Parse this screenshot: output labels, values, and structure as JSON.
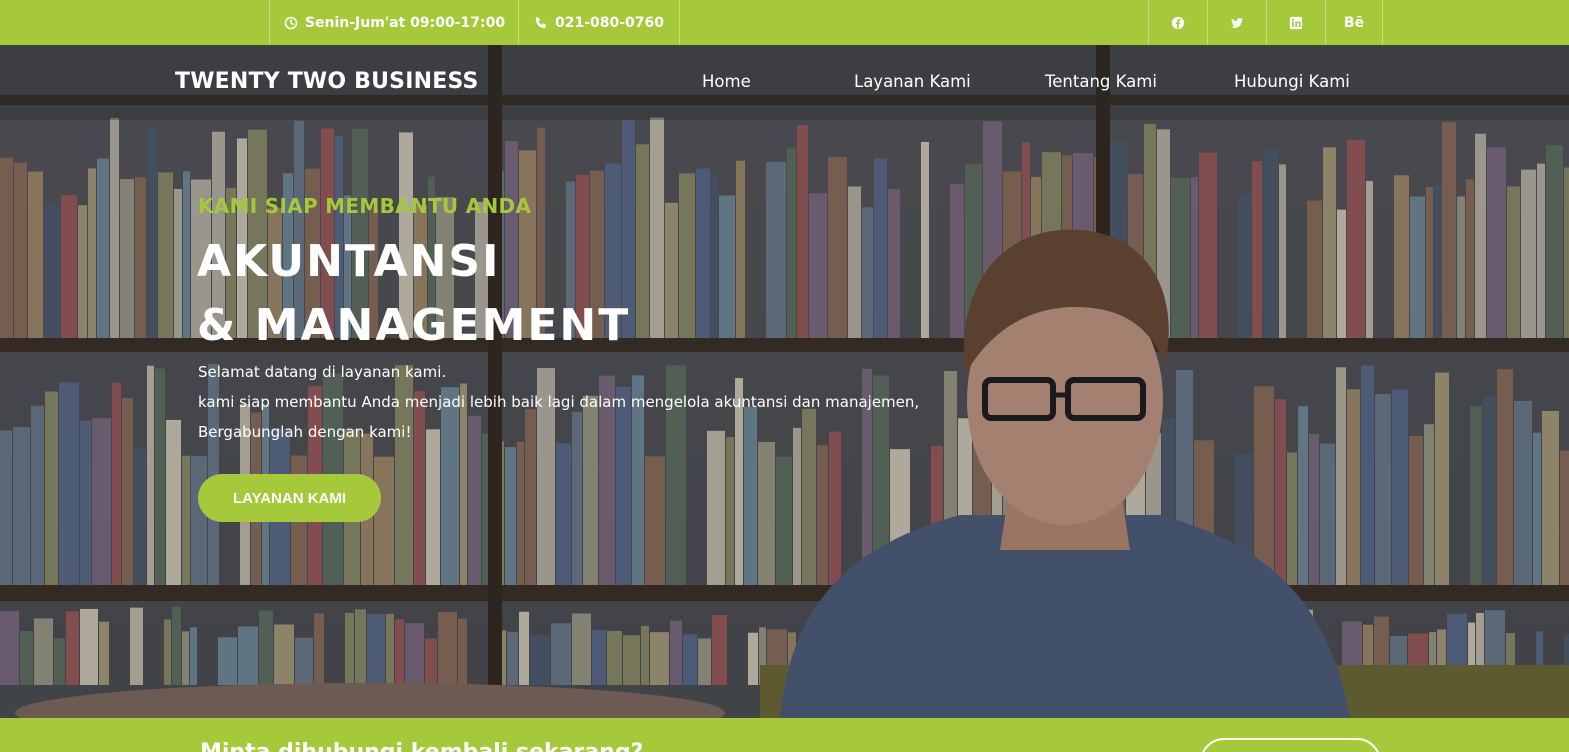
{
  "topbar": {
    "hours": "Senin-Jum'at 09:00-17:00",
    "phone": "021-080-0760",
    "social": [
      {
        "icon": "facebook-icon"
      },
      {
        "icon": "twitter-icon"
      },
      {
        "icon": "linkedin-icon"
      },
      {
        "icon": "behance-icon",
        "label": "Bē"
      }
    ]
  },
  "nav": {
    "brand": "TWENTY TWO BUSINESS",
    "links": [
      "Home",
      "Layanan Kami",
      "Tentang Kami",
      "Hubungi Kami"
    ]
  },
  "hero": {
    "kicker": "KAMI SIAP MEMBANTU ANDA",
    "title_line1": "AKUNTANSI",
    "title_line2": "& MANAGEMENT",
    "lead_line1": "Selamat datang di layanan kami.",
    "lead_line2": "kami siap membantu Anda menjadi lebih baik lagi dalam mengelola akuntansi dan manajemen,",
    "lead_line3": "Bergabunglah dengan kami!",
    "cta_label": "LAYANAN KAMI"
  },
  "contact_strip": {
    "text": "Minta dihubungi kembali sekarang?"
  },
  "colors": {
    "accent": "#a6c93b",
    "text": "#ffffff"
  }
}
